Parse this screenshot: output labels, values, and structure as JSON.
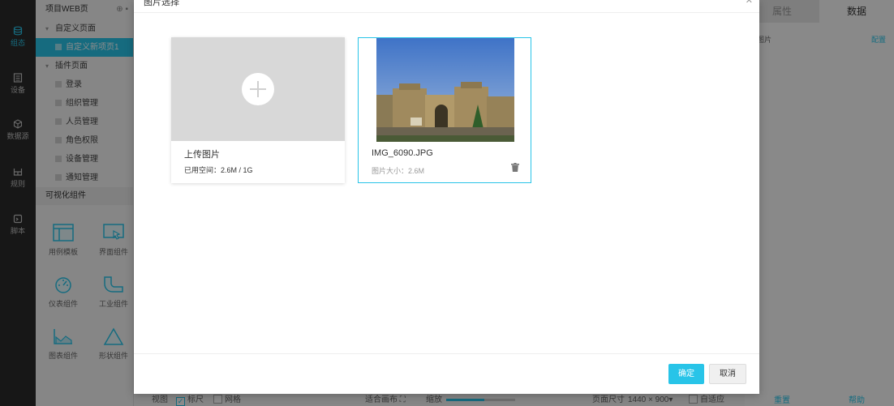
{
  "rail": [
    {
      "label": "组态",
      "icon": "database-icon",
      "active": true
    },
    {
      "label": "设备",
      "icon": "device-icon"
    },
    {
      "label": "数据源",
      "icon": "cube-icon"
    },
    {
      "label": "规则",
      "icon": "rule-icon"
    },
    {
      "label": "脚本",
      "icon": "script-icon"
    }
  ],
  "tree": {
    "header": "项目WEB页",
    "custom_group": "自定义页面",
    "custom_page": "自定义新项页1",
    "plugin_group": "插件页面",
    "plugin_pages": [
      "登录",
      "组织管理",
      "人员管理",
      "角色权限",
      "设备管理",
      "通知管理"
    ],
    "components_title": "可视化组件",
    "components": [
      "用例模板",
      "界面组件",
      "仪表组件",
      "工业组件",
      "图表组件",
      "形状组件"
    ]
  },
  "props": {
    "tab_attr": "属性",
    "tab_data": "数据",
    "row_label": "择图片",
    "row_link": "配置",
    "reset": "重置",
    "help": "帮助"
  },
  "bottombar": {
    "view": "视图",
    "ruler": "标尺",
    "grid": "网格",
    "fit": "适合画布",
    "zoom": "缩放",
    "zoom_level": 0.55,
    "page_size": "页面尺寸",
    "page_size_value": "1440 × 900▾",
    "adaptive": "自适应"
  },
  "modal": {
    "title": "图片选择",
    "upload_title": "上传图片",
    "upload_usage": "已用空间：2.6M / 1G",
    "image_name": "IMG_6090.JPG",
    "image_size": "图片大小：2.6M",
    "ok": "确定",
    "cancel": "取消"
  },
  "colors": {
    "accent": "#28c4e8"
  }
}
